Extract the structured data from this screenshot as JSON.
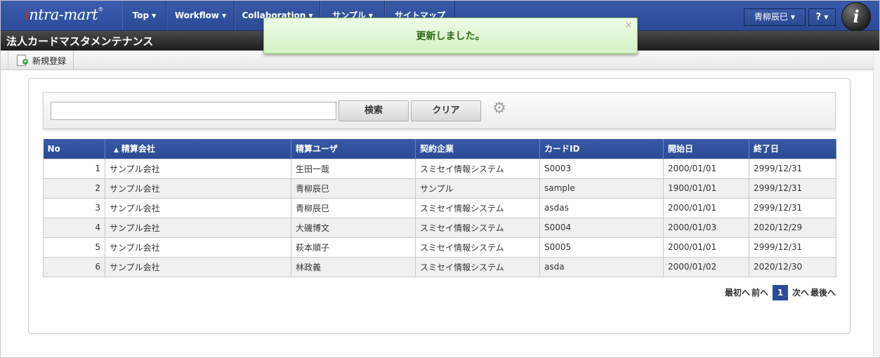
{
  "header": {
    "logo_text_i": "i",
    "logo_text_rest": "ntra-mart",
    "logo_reg": "®",
    "nav": [
      {
        "label": "Top"
      },
      {
        "label": "Workflow"
      },
      {
        "label": "Collaboration"
      },
      {
        "label": "サンプル"
      },
      {
        "label": "サイトマップ"
      }
    ],
    "user_label": "青柳辰巳",
    "help_label": "?",
    "im_logo": "i"
  },
  "page": {
    "title": "法人カードマスタメンテナンス"
  },
  "toolbar": {
    "new_label": "新規登録"
  },
  "toast": {
    "message": "更新しました。",
    "close": "×"
  },
  "search": {
    "value": "",
    "placeholder": "",
    "search_label": "検索",
    "clear_label": "クリア"
  },
  "table": {
    "sort_indicator": "▲",
    "headers": [
      "No",
      "精算会社",
      "精算ユーザ",
      "契約企業",
      "カードID",
      "開始日",
      "終了日"
    ],
    "rows": [
      {
        "no": "1",
        "company": "サンプル会社",
        "user": "生田一哉",
        "contractor": "スミセイ情報システム",
        "card_id": "S0003",
        "start": "2000/01/01",
        "end": "2999/12/31"
      },
      {
        "no": "2",
        "company": "サンプル会社",
        "user": "青柳辰巳",
        "contractor": "サンプル",
        "card_id": "sample",
        "start": "1900/01/01",
        "end": "2999/12/31"
      },
      {
        "no": "3",
        "company": "サンプル会社",
        "user": "青柳辰巳",
        "contractor": "スミセイ情報システム",
        "card_id": "asdas",
        "start": "2000/01/01",
        "end": "2999/12/31"
      },
      {
        "no": "4",
        "company": "サンプル会社",
        "user": "大磯博文",
        "contractor": "スミセイ情報システム",
        "card_id": "S0004",
        "start": "2000/01/03",
        "end": "2020/12/29"
      },
      {
        "no": "5",
        "company": "サンプル会社",
        "user": "萩本順子",
        "contractor": "スミセイ情報システム",
        "card_id": "S0005",
        "start": "2000/01/01",
        "end": "2999/12/31"
      },
      {
        "no": "6",
        "company": "サンプル会社",
        "user": "林政義",
        "contractor": "スミセイ情報システム",
        "card_id": "asda",
        "start": "2000/01/02",
        "end": "2020/12/30"
      }
    ]
  },
  "pager": {
    "first": "最初へ",
    "prev": "前へ",
    "current": "1",
    "next": "次へ",
    "last": "最後へ"
  },
  "colors": {
    "nav_blue": "#2c4c9a",
    "title_bar": "#2a2a2a",
    "toast_green": "#d3f1c3",
    "toast_text": "#2c6a12"
  }
}
